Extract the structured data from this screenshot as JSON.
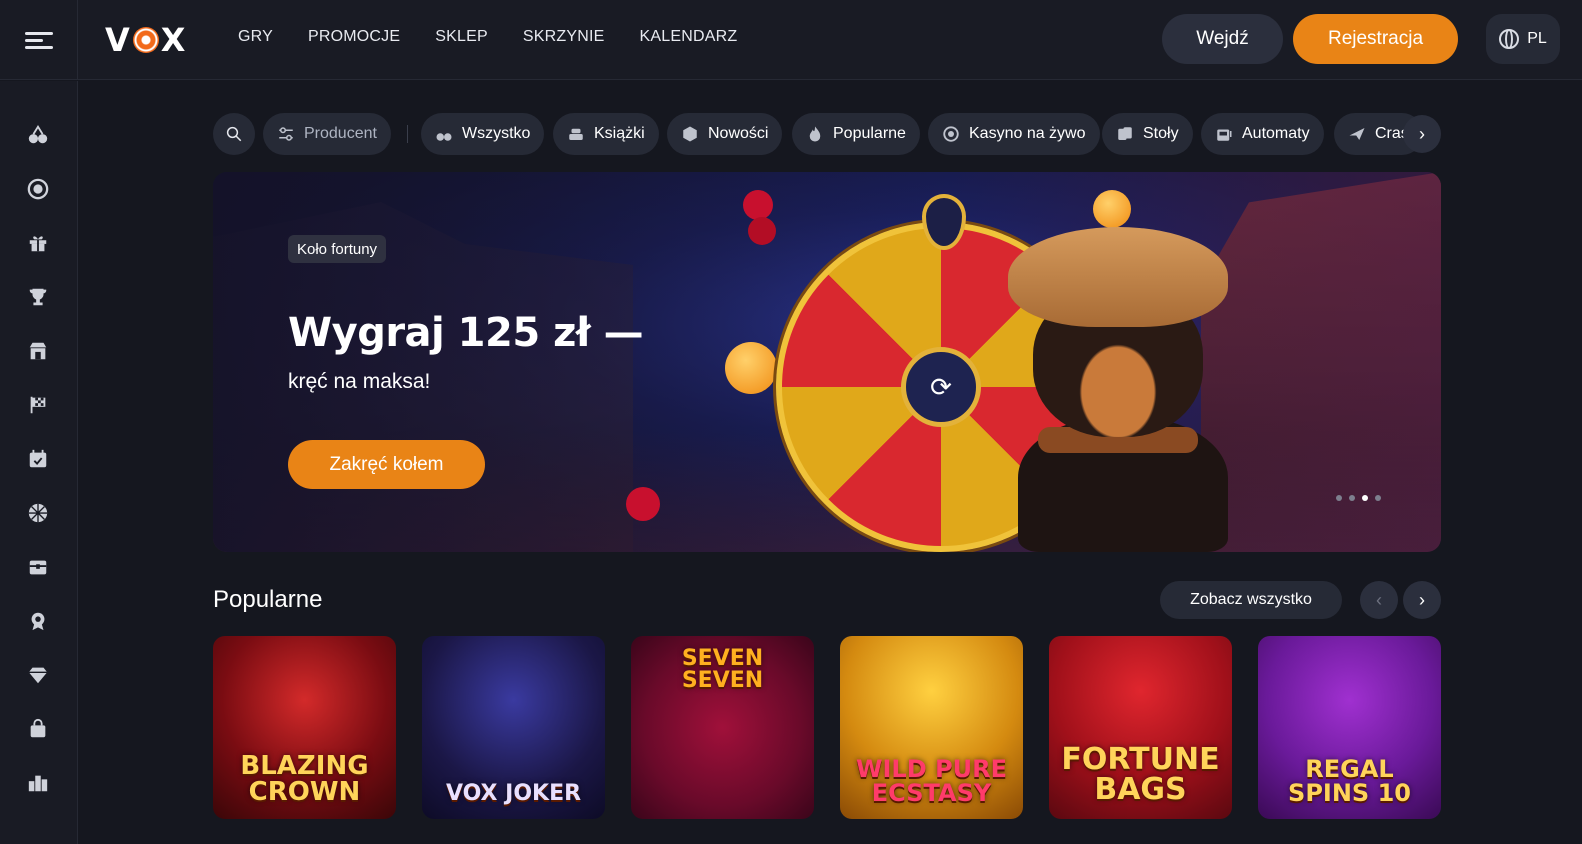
{
  "header": {
    "logo": "VOX",
    "nav": [
      "GRY",
      "PROMOCJE",
      "SKLEP",
      "SKRZYNIE",
      "KALENDARZ"
    ],
    "login_label": "Wejdź",
    "register_label": "Rejestracja",
    "language": "PL"
  },
  "sidebar": {
    "icons": [
      "cherries-icon",
      "roulette-icon",
      "gift-icon",
      "trophy-icon",
      "shop-icon",
      "race-flag-icon",
      "calendar-icon",
      "sports-ball-icon",
      "chest-icon",
      "badge-icon",
      "diamond-icon",
      "bag-icon",
      "leaderboard-icon"
    ]
  },
  "filters": {
    "producer_label": "Producent",
    "chips": [
      {
        "label": "Wszystko",
        "icon": "cherries-icon"
      },
      {
        "label": "Książki",
        "icon": "books-icon"
      },
      {
        "label": "Nowości",
        "icon": "cube-icon"
      },
      {
        "label": "Popularne",
        "icon": "flame-icon"
      },
      {
        "label": "Kasyno na żywo",
        "icon": "roulette-icon"
      },
      {
        "label": "Stoły",
        "icon": "cards-icon"
      },
      {
        "label": "Automaty",
        "icon": "slot-icon"
      },
      {
        "label": "Cras",
        "icon": "plane-icon"
      }
    ]
  },
  "banner": {
    "tag": "Koło fortuny",
    "headline": "Wygraj 125 zł —",
    "subtitle": "kręć na maksa!",
    "cta_label": "Zakręć kołem",
    "slides_total": 4,
    "slide_active": 3
  },
  "popular": {
    "title": "Popularne",
    "see_all_label": "Zobacz wszystko",
    "games": [
      {
        "title": "BLAZING CROWN",
        "bg": "#7a0c12"
      },
      {
        "title": "VOX JOKER",
        "bg": "#1b1747"
      },
      {
        "title": "SEVEN SEVEN",
        "bg": "#6a0a2a"
      },
      {
        "title": "WILD PURE ECSTASY",
        "bg": "#d48a10"
      },
      {
        "title": "FORTUNE BAGS",
        "bg": "#a0101a"
      },
      {
        "title": "REGAL SPINS 10",
        "bg": "#6a1a9a"
      }
    ]
  },
  "colors": {
    "accent": "#e98416",
    "background": "#15171f",
    "panel": "#191b24",
    "chip": "#262a36"
  }
}
